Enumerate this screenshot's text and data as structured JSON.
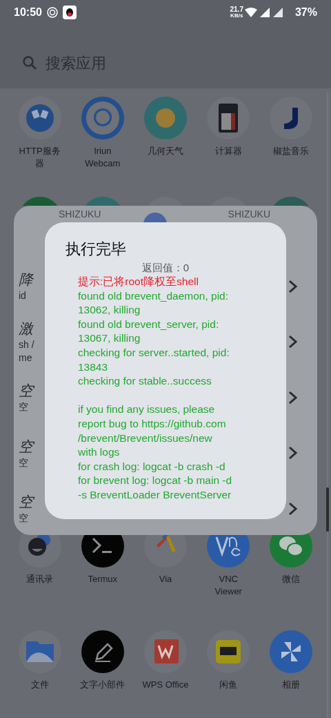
{
  "status_bar": {
    "time": "10:50",
    "speed": "21.7",
    "speed_unit": "KB/s",
    "battery": "37%"
  },
  "search": {
    "placeholder": "搜索应用"
  },
  "apps_top": [
    {
      "label": [
        "HTTP服务",
        "器"
      ]
    },
    {
      "label": [
        "Iriun",
        "Webcam"
      ]
    },
    {
      "label": [
        "几何天气"
      ]
    },
    {
      "label": [
        "计算器"
      ]
    },
    {
      "label": [
        "椒盐音乐"
      ]
    }
  ],
  "panel": {
    "header_left": "SHIZUKU",
    "header_right_title": "SHIZUKU",
    "rows": [
      {
        "title": "降",
        "lines": [
          "id"
        ]
      },
      {
        "title": "激",
        "lines": [
          "sh /",
          "me"
        ]
      },
      {
        "title": "空",
        "lines": [
          "空"
        ]
      },
      {
        "title": "空",
        "lines": [
          "空"
        ]
      },
      {
        "title": "空",
        "lines": [
          "空"
        ]
      }
    ]
  },
  "dialog": {
    "title": "执行完毕",
    "return_value": "返回值：0",
    "log_blocks": [
      [
        {
          "kind": "hint",
          "text": "提示:已将root降权至shell"
        },
        {
          "kind": "output",
          "text": "found old brevent_daemon, pid:"
        },
        {
          "kind": "output",
          "text": "13062, killing"
        },
        {
          "kind": "output",
          "text": "found old brevent_server, pid:"
        },
        {
          "kind": "output",
          "text": "13067, killing"
        },
        {
          "kind": "output",
          "text": "checking for server..started, pid:"
        },
        {
          "kind": "output",
          "text": "13843"
        },
        {
          "kind": "output",
          "text": "checking for stable..success"
        }
      ],
      [
        {
          "kind": "output",
          "text": "if you find any issues, please"
        },
        {
          "kind": "output",
          "text": "report bug to https://github.com"
        },
        {
          "kind": "output",
          "text": "/brevent/Brevent/issues/new"
        },
        {
          "kind": "output",
          "text": "with logs"
        },
        {
          "kind": "output",
          "text": "for crash log: logcat -b crash -d"
        },
        {
          "kind": "output",
          "text": "for brevent log: logcat -b main -d"
        },
        {
          "kind": "output",
          "text": "-s BreventLoader BreventServer"
        }
      ]
    ]
  },
  "apps_bottom": [
    [
      {
        "label": [
          "通讯录"
        ]
      },
      {
        "label": [
          "Termux"
        ]
      },
      {
        "label": [
          "Via"
        ]
      },
      {
        "label": [
          "VNC",
          "Viewer"
        ]
      },
      {
        "label": [
          "微信"
        ]
      }
    ],
    [
      {
        "label": [
          "文件"
        ]
      },
      {
        "label": [
          "文字小部件"
        ]
      },
      {
        "label": [
          "WPS Office"
        ]
      },
      {
        "label": [
          "闲鱼"
        ]
      },
      {
        "label": [
          "相册"
        ]
      }
    ]
  ]
}
